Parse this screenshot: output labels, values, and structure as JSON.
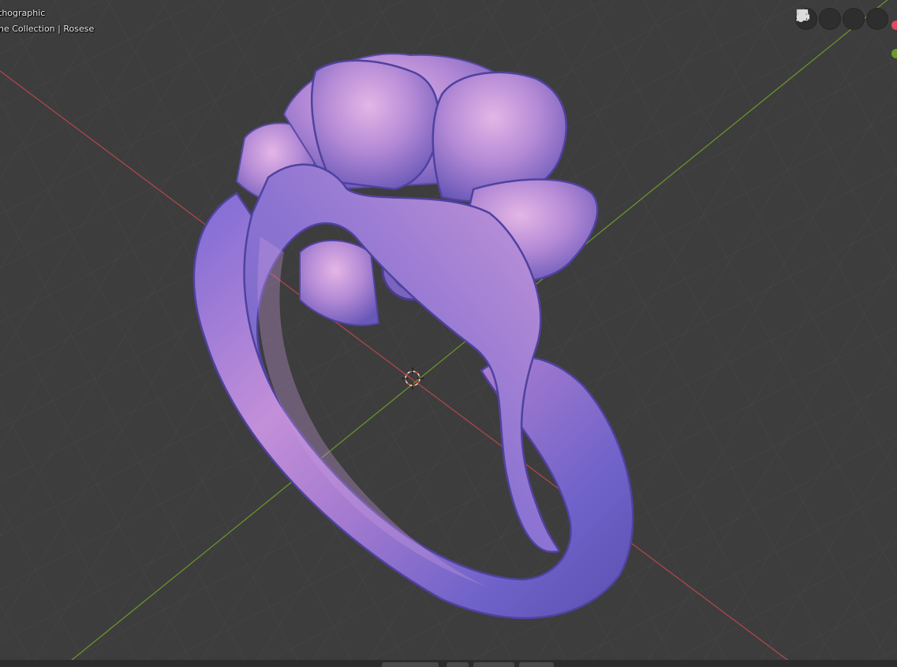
{
  "viewport": {
    "view_mode_text": "thographic",
    "collection_text": "ne Collection | Rosese",
    "nav_buttons": [
      {
        "icon": "grid-view-icon",
        "name": "toggle-view-grid-button"
      },
      {
        "icon": "camera-icon",
        "name": "camera-view-button"
      },
      {
        "icon": "hand-pan-icon",
        "name": "pan-view-button"
      },
      {
        "icon": "zoom-icon",
        "name": "zoom-view-button"
      }
    ],
    "axis_colors": {
      "x": "#e14a5d",
      "y": "#6a9a2a"
    },
    "grid_color": "#4a4a4a",
    "background_color": "#3d3d3d",
    "model_color": "#a77ccc"
  }
}
